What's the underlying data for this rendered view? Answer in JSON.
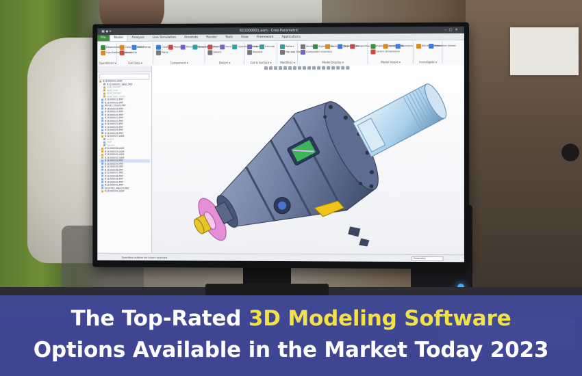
{
  "headline": {
    "line1_before": "The Top-Rated ",
    "line1_highlight": "3D Modeling Software",
    "line2": "Options Available in the Market Today 2023",
    "accent_color": "#f2e24a",
    "banner_color": "#464eaa"
  },
  "cad_app": {
    "window_title": "611000001.asm - Creo Parametric",
    "ribbon_tabs": [
      "File",
      "Model",
      "Analysis",
      "Live Simulation",
      "Annotate",
      "Render",
      "Tools",
      "View",
      "Framework",
      "Applications"
    ],
    "ribbon_groups": [
      "Operations",
      "Get Data",
      "Component",
      "Datum",
      "Cut & Surface",
      "Modifiers",
      "Model Display",
      "Model Intent",
      "Investigate"
    ],
    "ribbon_items": [
      "Regenerate",
      "User-Defined Feature",
      "Copy Geometry",
      "Shrinkwrap",
      "Assemble",
      "Create",
      "Repeat",
      "Mirror Component",
      "Drag Components",
      "Plane",
      "Axis",
      "Point",
      "Coordinate System",
      "Sketch",
      "Hole",
      "Extrude",
      "Revolve",
      "Pattern",
      "Manage Views",
      "Section",
      "Appearance",
      "Exploded View",
      "Display Style",
      "Perspective View",
      "Component Interface",
      "Publish Geometry",
      "Family Table",
      "Boundary",
      "Switch Dimensions",
      "Bill of Materials",
      "Reference Viewer"
    ],
    "model_tree": [
      "611000001.ASM",
      "611000001_SKEL.PRT",
      "ASM_RIGHT",
      "ASM_TOP",
      "ASM_FRONT",
      "ASM_DEF_CSYS",
      "611000012.PRT",
      "611000031.PRT",
      "M10x1.25x20.PRT",
      "611000018.PRT",
      "611000019.PRT",
      "611000020.PRT",
      "611000021.PRT",
      "611000022.PRT",
      "611000023.PRT",
      "611000024.PRT",
      "611000025.PRT",
      "611000026.PRT",
      "611000027.ASM",
      "RIGHT",
      "TOP",
      "FRONT",
      "611000028.ASM",
      "611000029.ASM",
      "611000030.ASM",
      "611000032.ASM",
      "611000033.PRT",
      "611000034.PRT",
      "611000035.PRT",
      "611000036.PRT",
      "611000037.PRT",
      "611000038.PRT",
      "611000039.PRT",
      "611000040.PRT",
      "611000041.PRT",
      "ISO4762_M8x20.PRT",
      "611000044.ASM"
    ],
    "status_message": "Specified outline for insert selected",
    "selection_filter": "Geometry"
  },
  "colors": {
    "part_body": "#6f7fa3",
    "shaft": "#a9d0eb",
    "flange_pink": "#e58fd6",
    "gear_yellow": "#e6c62b",
    "window_green": "#41c95a",
    "bracket_yellow": "#f0c419"
  }
}
